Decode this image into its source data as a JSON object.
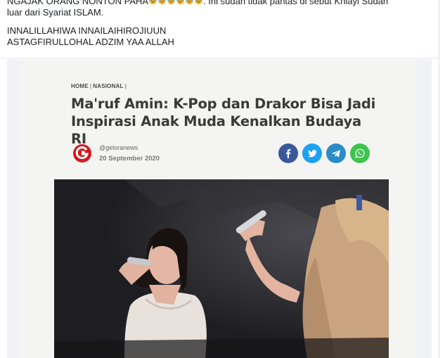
{
  "post": {
    "caption_line1_start": "NGAJAK ORANG NONTON PAHA",
    "caption_line1_end": ".  Ini sudah tidak pantas di sebut Khiayi Sudah",
    "caption_line2": "luar dari Syariat ISLAM.",
    "caption_line3": "INNALILLAHIWA INNAILAIHIROJIUUN",
    "caption_line4": "ASTAGFIRULLOHAL ADZIM YAA ALLAH",
    "emoji": "laughing-crying-face"
  },
  "article": {
    "breadcrumb_home": "HOME",
    "breadcrumb_section": "NASIONAL",
    "headline_line1": "Ma'ruf Amin: K-Pop dan Drakor Bisa Jadi",
    "headline_line2": "Inspirasi Anak Muda Kenalkan Budaya RI",
    "author": "@geloranews",
    "date": "20 September 2020"
  },
  "share": [
    {
      "name": "facebook",
      "color": "#3b5998",
      "icon": "facebook-icon"
    },
    {
      "name": "twitter",
      "color": "#1da1f2",
      "icon": "twitter-icon"
    },
    {
      "name": "telegram",
      "color": "#2a8bc8",
      "icon": "telegram-icon"
    },
    {
      "name": "whatsapp",
      "color": "#3fc34f",
      "icon": "whatsapp-icon"
    }
  ],
  "colors": {
    "brand": "#d51920",
    "page_bg": "#f0f2f5",
    "article_bg": "#f4f4f2"
  }
}
